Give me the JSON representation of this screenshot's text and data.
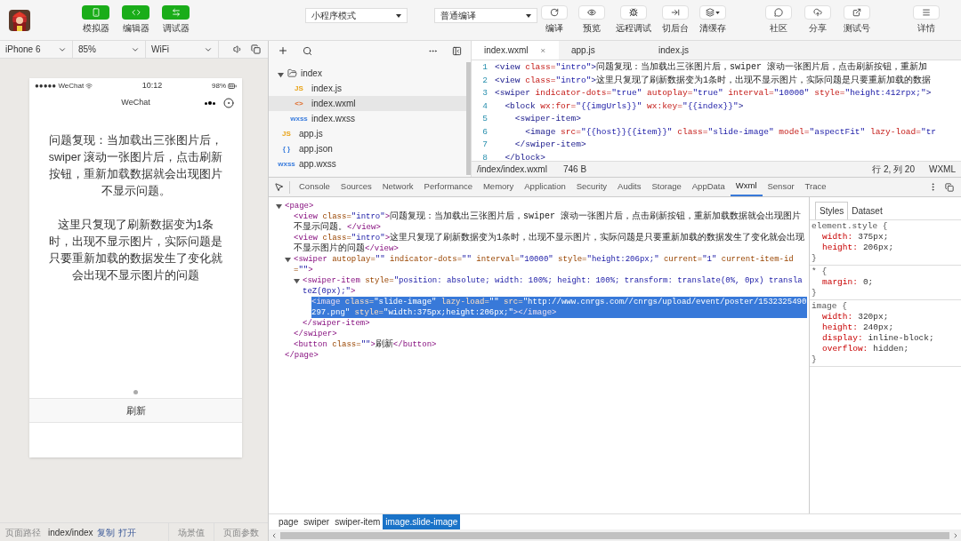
{
  "toolbar": {
    "left_buttons": [
      {
        "label": "模拟器",
        "on": true
      },
      {
        "label": "编辑器",
        "on": true
      },
      {
        "label": "调试器",
        "on": true
      }
    ],
    "mode_select": "小程序模式",
    "compile_select": "普通编译",
    "actions": [
      {
        "label": "编译"
      },
      {
        "label": "预览"
      },
      {
        "label": "远程调试"
      },
      {
        "label": "切后台"
      },
      {
        "label": "清缓存"
      }
    ],
    "right_actions": [
      {
        "label": "社区"
      },
      {
        "label": "分享"
      },
      {
        "label": "测试号"
      },
      {
        "label": "详情"
      }
    ]
  },
  "simulator": {
    "device": "iPhone 6",
    "zoom": "85%",
    "network": "WiFi",
    "status_bar": {
      "carrier": "●●●●● WeChat",
      "time": "10:12",
      "battery": "98%"
    },
    "nav_title": "WeChat",
    "paragraphs": [
      "问题复现：当加载出三张图片后，swiper 滚动一张图片后，点击刷新按钮，重新加载数据就会出现图片不显示问题。",
      "这里只复现了刷新数据变为1条时，出现不显示图片，实际问题是只要重新加载的数据发生了变化就会出现不显示图片的问题"
    ],
    "swiper_dots": [
      {
        "selected": true
      }
    ],
    "button": "刷新"
  },
  "footer": {
    "path_label": "页面路径",
    "path": "index/index",
    "links": [
      "复制",
      "打开"
    ],
    "tabs": [
      "场景值",
      "页面参数"
    ]
  },
  "file_tree": [
    {
      "name": "index",
      "kind": "folder",
      "expanded": true,
      "selected": false,
      "children": [
        {
          "name": "index.js",
          "kind": "js",
          "badge": "JS",
          "selected": false
        },
        {
          "name": "index.wxml",
          "kind": "wxml",
          "badge": "<>",
          "selected": true
        },
        {
          "name": "index.wxss",
          "kind": "wxss",
          "badge": "wxss",
          "selected": false
        }
      ]
    },
    {
      "name": "app.js",
      "kind": "js",
      "badge": "JS",
      "selected": false
    },
    {
      "name": "app.json",
      "kind": "json",
      "badge": "{ }",
      "selected": false
    },
    {
      "name": "app.wxss",
      "kind": "wxss",
      "badge": "wxss",
      "selected": false
    }
  ],
  "editor": {
    "tabs": [
      {
        "label": "index.wxml",
        "selected": true,
        "closable": true
      },
      {
        "label": "app.js",
        "selected": false,
        "closable": false
      },
      {
        "label": "index.js",
        "selected": false,
        "closable": false
      }
    ],
    "lines": [
      {
        "number": "1",
        "segments": [
          {
            "kind": "tag",
            "text": "<view"
          },
          {
            "kind": "attr",
            "text": " class="
          },
          {
            "kind": "value",
            "text": "\"intro\""
          },
          {
            "kind": "tag",
            "text": ">"
          },
          {
            "kind": "text",
            "text": "问题复现：当加载出三张图片后，swiper 滚动一张图片后，点击刷新按钮，重新加"
          }
        ]
      },
      {
        "number": "2",
        "segments": [
          {
            "kind": "tag",
            "text": "<view"
          },
          {
            "kind": "attr",
            "text": " class="
          },
          {
            "kind": "value",
            "text": "\"intro\""
          },
          {
            "kind": "tag",
            "text": ">"
          },
          {
            "kind": "text",
            "text": "这里只复现了刷新数据变为1条时，出现不显示图片，实际问题是只要重新加载的数据"
          }
        ]
      },
      {
        "number": "3",
        "segments": [
          {
            "kind": "tag",
            "text": "<swiper"
          },
          {
            "kind": "attr",
            "text": " indicator-dots="
          },
          {
            "kind": "value",
            "text": "\"true\""
          },
          {
            "kind": "attr",
            "text": " autoplay="
          },
          {
            "kind": "value",
            "text": "\"true\""
          },
          {
            "kind": "attr",
            "text": " interval="
          },
          {
            "kind": "value",
            "text": "\"10000\""
          },
          {
            "kind": "attr",
            "text": " style="
          },
          {
            "kind": "value",
            "text": "\"height:412rpx;\""
          },
          {
            "kind": "tag",
            "text": ">"
          }
        ]
      },
      {
        "number": "4",
        "segments": [
          {
            "kind": "tag",
            "text": "  <block"
          },
          {
            "kind": "attr",
            "text": " wx:for="
          },
          {
            "kind": "value",
            "text": "\"{{imgUrls}}\""
          },
          {
            "kind": "attr",
            "text": " wx:key="
          },
          {
            "kind": "value",
            "text": "\"{{index}}\""
          },
          {
            "kind": "tag",
            "text": ">"
          }
        ]
      },
      {
        "number": "5",
        "segments": [
          {
            "kind": "tag",
            "text": "    <swiper-item>"
          }
        ]
      },
      {
        "number": "6",
        "segments": [
          {
            "kind": "tag",
            "text": "      <image"
          },
          {
            "kind": "attr",
            "text": " src="
          },
          {
            "kind": "value",
            "text": "\"{{host}}{{item}}\""
          },
          {
            "kind": "attr",
            "text": " class="
          },
          {
            "kind": "value",
            "text": "\"slide-image\""
          },
          {
            "kind": "attr",
            "text": " model="
          },
          {
            "kind": "value",
            "text": "\"aspectFit\""
          },
          {
            "kind": "attr",
            "text": " lazy-load="
          },
          {
            "kind": "value",
            "text": "\"tr"
          }
        ]
      },
      {
        "number": "7",
        "segments": [
          {
            "kind": "tag",
            "text": "    </swiper-item>"
          }
        ]
      },
      {
        "number": "8",
        "segments": [
          {
            "kind": "tag",
            "text": "  </block>"
          }
        ]
      }
    ],
    "status": {
      "path": "/index/index.wxml",
      "size": "746 B",
      "position": "行 2, 列 20",
      "language": "WXML"
    }
  },
  "devtools": {
    "tabs": [
      {
        "label": "Console",
        "selected": false
      },
      {
        "label": "Sources",
        "selected": false
      },
      {
        "label": "Network",
        "selected": false
      },
      {
        "label": "Performance",
        "selected": false
      },
      {
        "label": "Memory",
        "selected": false
      },
      {
        "label": "Application",
        "selected": false
      },
      {
        "label": "Security",
        "selected": false
      },
      {
        "label": "Audits",
        "selected": false
      },
      {
        "label": "Storage",
        "selected": false
      },
      {
        "label": "AppData",
        "selected": false
      },
      {
        "label": "Wxml",
        "selected": true
      },
      {
        "label": "Sensor",
        "selected": false
      },
      {
        "label": "Trace",
        "selected": false
      }
    ],
    "tree": [
      {
        "selected": false,
        "expanded": true,
        "open": [
          {
            "kind": "tag",
            "text": "<page>"
          }
        ],
        "close": [
          {
            "kind": "tag",
            "text": "</page>"
          }
        ],
        "children": [
          {
            "selected": false,
            "open": [
              {
                "kind": "tag",
                "text": "<view"
              },
              {
                "kind": "attr",
                "text": " class="
              },
              {
                "kind": "value",
                "text": "\"intro\""
              },
              {
                "kind": "tag",
                "text": ">"
              },
              {
                "kind": "text",
                "text": "问题复现：当加载出三张图片后，swiper 滚动一张图片后，点击刷新按钮，重新加载数据就会出现图片不显示问题。"
              },
              {
                "kind": "tag",
                "text": "</view>"
              }
            ]
          },
          {
            "selected": false,
            "open": [
              {
                "kind": "tag",
                "text": "<view"
              },
              {
                "kind": "attr",
                "text": " class="
              },
              {
                "kind": "value",
                "text": "\"intro\""
              },
              {
                "kind": "tag",
                "text": ">"
              },
              {
                "kind": "text",
                "text": "这里只复现了刷新数据变为1条时，出现不显示图片，实际问题是只要重新加载的数据发生了变化就会出现不显示图片的问题"
              },
              {
                "kind": "tag",
                "text": "</view>"
              }
            ]
          },
          {
            "selected": false,
            "expanded": true,
            "open": [
              {
                "kind": "tag",
                "text": "<swiper"
              },
              {
                "kind": "attr",
                "text": " autoplay="
              },
              {
                "kind": "value",
                "text": "\"\""
              },
              {
                "kind": "attr",
                "text": " indicator-dots="
              },
              {
                "kind": "value",
                "text": "\"\""
              },
              {
                "kind": "attr",
                "text": " interval="
              },
              {
                "kind": "value",
                "text": "\"10000\""
              },
              {
                "kind": "attr",
                "text": " style="
              },
              {
                "kind": "value",
                "text": "\"height:206px;\""
              },
              {
                "kind": "attr",
                "text": " current="
              },
              {
                "kind": "value",
                "text": "\"1\""
              },
              {
                "kind": "attr",
                "text": " current-item-id="
              },
              {
                "kind": "value",
                "text": "\"\""
              },
              {
                "kind": "tag",
                "text": ">"
              }
            ],
            "close": [
              {
                "kind": "tag",
                "text": "</swiper>"
              }
            ],
            "children": [
              {
                "selected": false,
                "expanded": true,
                "open": [
                  {
                    "kind": "tag",
                    "text": "<swiper-item"
                  },
                  {
                    "kind": "attr",
                    "text": " style="
                  },
                  {
                    "kind": "value",
                    "text": "\"position: absolute; width: 100%; height: 100%; transform: translate(0%, 0px) translateZ(0px);\""
                  },
                  {
                    "kind": "tag",
                    "text": ">"
                  }
                ],
                "close": [
                  {
                    "kind": "tag",
                    "text": "</swiper-item>"
                  }
                ],
                "children": [
                  {
                    "selected": true,
                    "open": [
                      {
                        "kind": "tag",
                        "text": "<image"
                      },
                      {
                        "kind": "attr",
                        "text": " class="
                      },
                      {
                        "kind": "value",
                        "text": "\"slide-image\""
                      },
                      {
                        "kind": "attr",
                        "text": " lazy-load="
                      },
                      {
                        "kind": "value",
                        "text": "\"\""
                      },
                      {
                        "kind": "attr",
                        "text": " src="
                      },
                      {
                        "kind": "value",
                        "text": "\"http://www.cnrgs.com//cnrgs/upload/event/poster/1532325490297.png\""
                      },
                      {
                        "kind": "attr",
                        "text": " style="
                      },
                      {
                        "kind": "value",
                        "text": "\"width:375px;height:206px;\""
                      },
                      {
                        "kind": "tag",
                        "text": "></image>"
                      }
                    ]
                  }
                ]
              }
            ]
          },
          {
            "selected": false,
            "open": [
              {
                "kind": "tag",
                "text": "<button"
              },
              {
                "kind": "attr",
                "text": " class="
              },
              {
                "kind": "value",
                "text": "\"\""
              },
              {
                "kind": "tag",
                "text": ">"
              },
              {
                "kind": "text",
                "text": "刷新"
              },
              {
                "kind": "tag",
                "text": "</button>"
              }
            ]
          }
        ]
      }
    ],
    "style_tabs": [
      {
        "label": "Styles",
        "selected": true
      },
      {
        "label": "Dataset",
        "selected": false
      }
    ],
    "rules": [
      {
        "selector": "element.style {",
        "props": [
          {
            "name": "width:",
            "value": "375px;"
          },
          {
            "name": "height:",
            "value": "206px;"
          }
        ],
        "end": "}"
      },
      {
        "selector": "* {",
        "props": [
          {
            "name": "margin:",
            "value": "0;"
          }
        ],
        "end": "}"
      },
      {
        "selector": "image {",
        "props": [
          {
            "name": "width:",
            "value": "320px;"
          },
          {
            "name": "height:",
            "value": "240px;"
          },
          {
            "name": "display:",
            "value": "inline-block;"
          },
          {
            "name": "overflow:",
            "value": "hidden;"
          }
        ],
        "end": "}"
      }
    ],
    "breadcrumb": [
      {
        "label": "page",
        "selected": false
      },
      {
        "label": "swiper",
        "selected": false
      },
      {
        "label": "swiper-item",
        "selected": false
      },
      {
        "label": "image.slide-image",
        "selected": true
      }
    ]
  }
}
